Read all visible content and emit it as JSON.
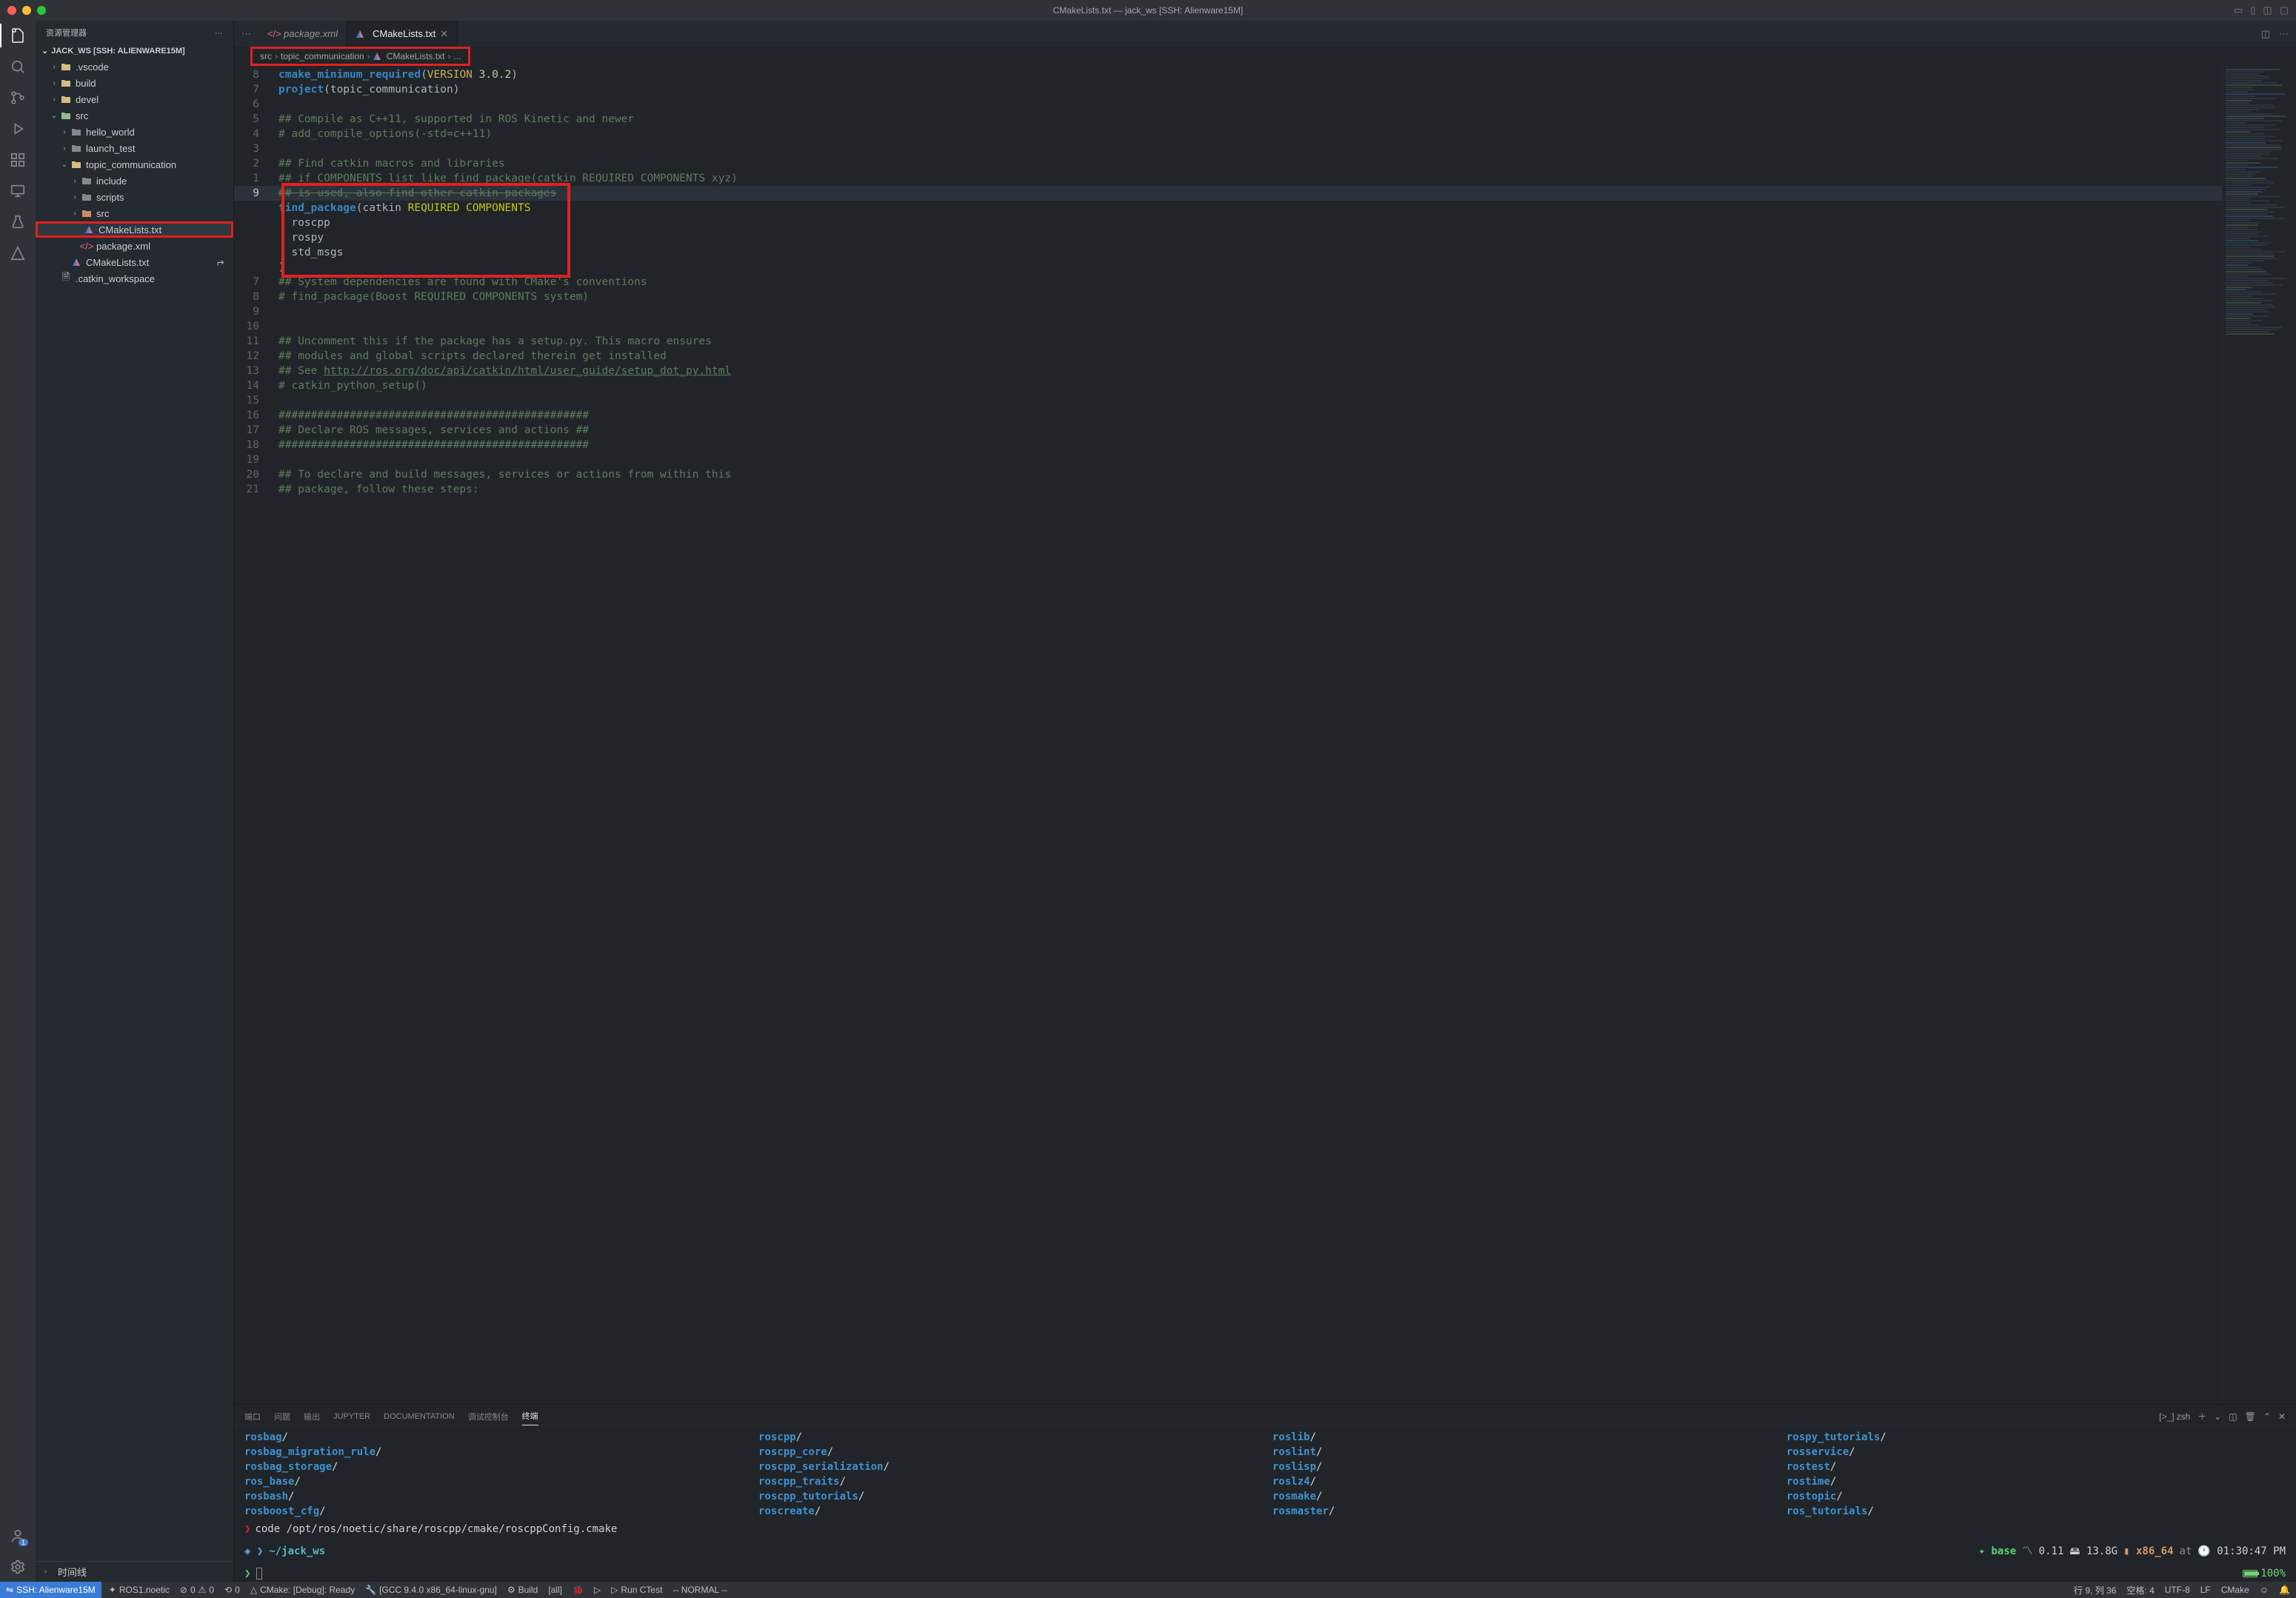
{
  "titlebar": {
    "title": "CMakeLists.txt — jack_ws [SSH: Alienware15M]"
  },
  "sidebar": {
    "title": "资源管理器",
    "workspace_header": "JACK_WS [SSH: ALIENWARE15M]",
    "timeline_label": "时间线",
    "tree": {
      "vscode": ".vscode",
      "build": "build",
      "devel": "devel",
      "src": "src",
      "hello_world": "hello_world",
      "launch_test": "launch_test",
      "topic_communication": "topic_communication",
      "include": "include",
      "scripts": "scripts",
      "src_inner": "src",
      "cmakelists_inner": "CMakeLists.txt",
      "package_xml": "package.xml",
      "cmakelists_outer": "CMakeLists.txt",
      "catkin_workspace": ".catkin_workspace"
    }
  },
  "tabs": {
    "package_xml": "package.xml",
    "cmakelists": "CMakeLists.txt"
  },
  "breadcrumb": {
    "seg1": "src",
    "seg2": "topic_communication",
    "seg3": "CMakeLists.txt",
    "seg4": "..."
  },
  "code": {
    "l8_gutter": "8",
    "l8_a": "cmake_minimum_required",
    "l8_b": "(",
    "l8_c": "VERSION",
    "l8_d": " 3.0.2",
    "l8_e": ")",
    "l7_gutter": "7",
    "l7_a": "project",
    "l7_b": "(topic_communication)",
    "l6_gutter": "6",
    "l5_gutter": "5",
    "l5_t": "## Compile as C++11, supported in ROS Kinetic and newer",
    "l4_gutter": "4",
    "l4_t": "# add_compile_options(-std=c++11)",
    "l3_gutter": "3",
    "l2_gutter": "2",
    "l2_t": "## Find catkin macros and libraries",
    "l1_gutter": "1",
    "l1_t": "## if COMPONENTS list like find_package(catkin REQUIRED COMPONENTS xyz)",
    "l9_gutter": "9",
    "l9_t": "## is used, also find other catkin packages",
    "lfp_a": "find_package",
    "lfp_b": "(catkin ",
    "lfp_c": "REQUIRED COMPONENTS",
    "lfp_roscpp": "  roscpp",
    "lfp_rospy": "  rospy",
    "lfp_stdmsgs": "  std_msgs",
    "lfp_close": ")",
    "l7b_gutter": "7",
    "l7b_t": "## System dependencies are found with CMake's conventions",
    "l8b_gutter": "8",
    "l8b_t": "# find_package(Boost REQUIRED COMPONENTS system)",
    "l9b_gutter": "9",
    "l10_gutter": "10",
    "l11_gutter": "11",
    "l11_t": "## Uncomment this if the package has a setup.py. This macro ensures",
    "l12_gutter": "12",
    "l12_t": "## modules and global scripts declared therein get installed",
    "l13_gutter": "13",
    "l13_a": "## See ",
    "l13_b": "http://ros.org/doc/api/catkin/html/user_guide/setup_dot_py.html",
    "l14_gutter": "14",
    "l14_t": "# catkin_python_setup()",
    "l15_gutter": "15",
    "l16_gutter": "16",
    "l16_t": "################################################",
    "l17_gutter": "17",
    "l17_t": "## Declare ROS messages, services and actions ##",
    "l18_gutter": "18",
    "l18_t": "################################################",
    "l19_gutter": "19",
    "l20_gutter": "20",
    "l20_t": "## To declare and build messages, services or actions from within this",
    "l21_gutter": "21",
    "l21_t": "## package, follow these steps:"
  },
  "panel": {
    "tab_port": "端口",
    "tab_problems": "问题",
    "tab_output": "输出",
    "tab_jupyter": "JUPYTER",
    "tab_documentation": "DOCUMENTATION",
    "tab_debug": "调试控制台",
    "tab_terminal": "终端",
    "shell_label": "zsh",
    "cols": [
      [
        "rosbag",
        "rosbag_migration_rule",
        "rosbag_storage",
        "ros_base",
        "rosbash",
        "rosboost_cfg"
      ],
      [
        "roscpp",
        "roscpp_core",
        "roscpp_serialization",
        "roscpp_traits",
        "roscpp_tutorials",
        "roscreate"
      ],
      [
        "roslib",
        "roslint",
        "roslisp",
        "roslz4",
        "rosmake",
        "rosmaster"
      ],
      [
        "rospy_tutorials",
        "rosservice",
        "rostest",
        "rostime",
        "rostopic",
        "ros_tutorials"
      ]
    ],
    "cmd_prefix": "❯",
    "cmd": "code /opt/ros/noetic/share/roscpp/cmake/roscppConfig.cmake",
    "statusline": {
      "chev": "◈ ❯",
      "path": "~/jack_ws",
      "base_label": "base",
      "metric_icon": "📊",
      "metric1": "0.11",
      "disk_icon": "💾",
      "metric2": "13.8G",
      "arch_icon": "▮",
      "arch": "x86_64",
      "at": "at",
      "clock_icon": "⏱",
      "time": "01:30:47 PM",
      "battery": "100%"
    },
    "prompt2": "❯"
  },
  "statusbar": {
    "remote": "SSH: Alienware15M",
    "ros": "ROS1.noetic",
    "errors": "0",
    "warnings": "0",
    "ports": "0",
    "cmake": "CMake: [Debug]: Ready",
    "kit": "[GCC 9.4.0 x86_64-linux-gnu]",
    "build": "Build",
    "target": "[all]",
    "debug_label": "",
    "run_ctest": "Run CTest",
    "mode": "-- NORMAL --",
    "pos": "行 9, 列 36",
    "spaces": "空格: 4",
    "encoding": "UTF-8",
    "eol": "LF",
    "lang": "CMake"
  },
  "account_badge": "1"
}
